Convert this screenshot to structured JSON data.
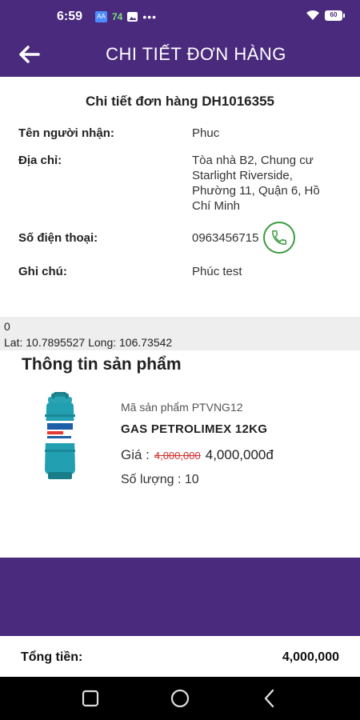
{
  "status_bar": {
    "time": "6:59",
    "notif_box": "AA",
    "notif_count": "74",
    "dots": "•••",
    "battery": "60"
  },
  "app_bar": {
    "title": "CHI TIẾT ĐƠN HÀNG",
    "back_icon": "arrow-left-icon"
  },
  "order": {
    "title": "Chi tiết đơn hàng DH1016355",
    "recipient_label": "Tên người nhận:",
    "recipient_value": "Phuc",
    "address_label": "Địa chỉ:",
    "address_value": "Tòa nhà B2, Chung cư Starlight Riverside, Phường 11, Quận 6, Hồ Chí Minh",
    "phone_label": "Số điện thoại:",
    "phone_value": "0963456715",
    "note_label": "Ghi chú:",
    "note_value": "Phúc test"
  },
  "location": {
    "line1": "0",
    "line2": "Lat: 10.7895527 Long: 106.73542"
  },
  "product_section": {
    "heading": "Thông tin sản phẩm",
    "code": "Mã sản phẩm PTVNG12",
    "name": "GAS PETROLIMEX 12KG",
    "price_label": "Giá :",
    "price_old": "4,000,000",
    "price_new": "4,000,000đ",
    "quantity": "Số lượng : 10"
  },
  "total": {
    "label": "Tổng tiền:",
    "value": "4,000,000"
  },
  "colors": {
    "primary": "#4a2a7c",
    "call_green": "#3a9b3f",
    "old_price_red": "#d32f2f"
  }
}
